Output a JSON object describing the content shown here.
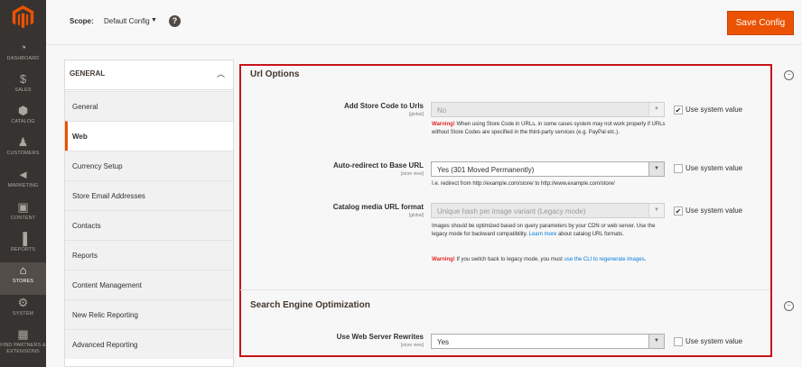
{
  "nav": {
    "items": [
      {
        "label": "Dashboard",
        "icon": "speedometer-icon",
        "glyph": "◔"
      },
      {
        "label": "Sales",
        "icon": "dollar-icon",
        "glyph": "$"
      },
      {
        "label": "Catalog",
        "icon": "cube-icon",
        "glyph": "⬢"
      },
      {
        "label": "Customers",
        "icon": "person-icon",
        "glyph": "♟"
      },
      {
        "label": "Marketing",
        "icon": "megaphone-icon",
        "glyph": "◄"
      },
      {
        "label": "Content",
        "icon": "layout-icon",
        "glyph": "▣"
      },
      {
        "label": "Reports",
        "icon": "bar-chart-icon",
        "glyph": "▐"
      },
      {
        "label": "Stores",
        "icon": "store-icon",
        "glyph": "⌂"
      },
      {
        "label": "System",
        "icon": "gear-icon",
        "glyph": "⚙"
      },
      {
        "label": "Find Partners & Extensions",
        "icon": "box-icon",
        "glyph": "▦"
      }
    ],
    "active": "Stores"
  },
  "header": {
    "scope_label": "Scope:",
    "scope_value": "Default Config",
    "help": "?",
    "save_label": "Save Config"
  },
  "tabs": {
    "title": "General",
    "items": [
      {
        "label": "General"
      },
      {
        "label": "Web"
      },
      {
        "label": "Currency Setup"
      },
      {
        "label": "Store Email Addresses"
      },
      {
        "label": "Contacts"
      },
      {
        "label": "Reports"
      },
      {
        "label": "Content Management"
      },
      {
        "label": "New Relic Reporting"
      },
      {
        "label": "Advanced Reporting"
      }
    ],
    "active": "Web"
  },
  "url_options": {
    "title": "Url Options",
    "fields": [
      {
        "label": "Add Store Code to Urls",
        "scope": "[global]",
        "value": "No",
        "use_system": "Use system value",
        "use_system_checked": true,
        "disabled": true
      },
      {
        "label": "Auto-redirect to Base URL",
        "scope": "[store view]",
        "value": "Yes (301 Moved Permanently)",
        "use_system": "Use system value",
        "use_system_checked": false,
        "disabled": false,
        "note": "I.e. redirect from http://example.com/store/ to http://www.example.com/store/"
      },
      {
        "label": "Catalog media URL format",
        "scope": "[global]",
        "value": "Unique hash per image variant (Legacy mode)",
        "use_system": "Use system value",
        "use_system_checked": true,
        "disabled": true
      }
    ],
    "warning_store_code": {
      "label": "Warning!",
      "text": " When using Store Code in URLs, in some cases system may not work properly if URLs without Store Codes are specified in the third-party services (e.g. PayPal etc.)."
    },
    "media_note": {
      "text": "Images should be optimized based on query parameters by your CDN or web server. Use the legacy mode for backward compatibility. ",
      "link": "Learn more",
      "after": " about catalog URL formats."
    },
    "media_warning": {
      "label": "Warning!",
      "text": " If you switch back to legacy mode, you must ",
      "link": "use the CLI to regenerate images",
      "after": "."
    }
  },
  "seo": {
    "title": "Search Engine Optimization",
    "field": {
      "label": "Use Web Server Rewrites",
      "scope": "[store view]",
      "value": "Yes",
      "use_system": "Use system value",
      "use_system_checked": false
    }
  },
  "colors": {
    "accent": "#eb5202",
    "highlight": "#c6141c",
    "sidebar": "#373330",
    "warning": "#e22626",
    "link": "#007bdb"
  }
}
